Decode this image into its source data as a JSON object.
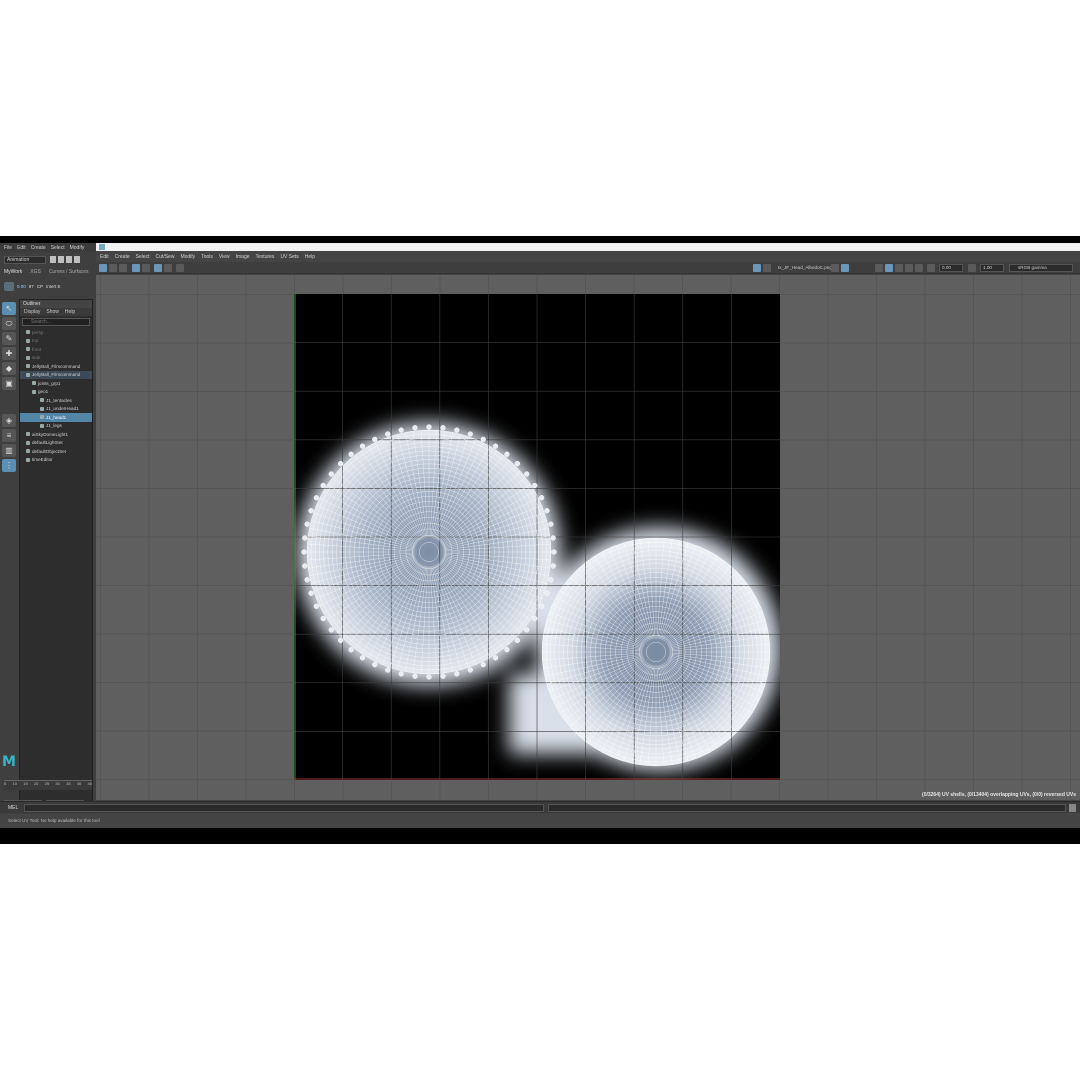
{
  "main_menu": [
    "File",
    "Edit",
    "Create",
    "Select",
    "Modify"
  ],
  "mode_selector": "Animation",
  "shelf_tabs": [
    "MyWork",
    "XGS",
    "Curves / Surfaces"
  ],
  "shelf_numbers": [
    "0.00",
    "87",
    "CP",
    "Intert E"
  ],
  "outliner": {
    "title": "Outliner",
    "menu": [
      "Display",
      "Show",
      "Help"
    ],
    "search_placeholder": "Search...",
    "items": [
      {
        "label": "persp",
        "state": "dim"
      },
      {
        "label": "top",
        "state": "dim"
      },
      {
        "label": "front",
        "state": "dim"
      },
      {
        "label": "side",
        "state": "dim"
      },
      {
        "label": "JellyBall_Filmcommand",
        "state": "normal"
      },
      {
        "label": "JellyBall_Filmcommand",
        "state": "hover"
      },
      {
        "label": "joints_grp1",
        "state": "normal"
      },
      {
        "label": "geo1",
        "state": "normal"
      },
      {
        "label": "J1_tentacles",
        "state": "normal"
      },
      {
        "label": "J1_underHead1",
        "state": "normal"
      },
      {
        "label": "J1_head1",
        "state": "selected"
      },
      {
        "label": "J1_legs",
        "state": "normal"
      },
      {
        "label": "aiSkyDomeLight1",
        "state": "normal"
      },
      {
        "label": "defaultLightSet",
        "state": "normal"
      },
      {
        "label": "defaultObjectSet",
        "state": "normal"
      },
      {
        "label": "timeEditor",
        "state": "normal"
      }
    ]
  },
  "timeline_ticks": [
    "5",
    "10",
    "15",
    "20",
    "25",
    "30",
    "35",
    "40",
    "45"
  ],
  "range_start": "0",
  "range_end": "0",
  "uv_menu": [
    "Edit",
    "Create",
    "Select",
    "Cut/Sew",
    "Modify",
    "Tools",
    "View",
    "Image",
    "Textures",
    "UV Sets",
    "Help"
  ],
  "uv_toolbar": {
    "image_name": "tx_JF_Head_AlbedoC.png",
    "exposure": "0.00",
    "gamma": "1.00",
    "color_space": "sRGB gamma"
  },
  "uv_status": "(0/3264) UV shells, (0/13404) overlapping UVs, (0/0) reversed UVs",
  "command_language": "MEL",
  "help_line": "Select UV Tool: No help available for this tool",
  "colors": {
    "app_bg": "#444444",
    "selection_blue": "#5285a6",
    "maya_logo": "#34b5c8",
    "uv_wire": "#ffffff"
  }
}
